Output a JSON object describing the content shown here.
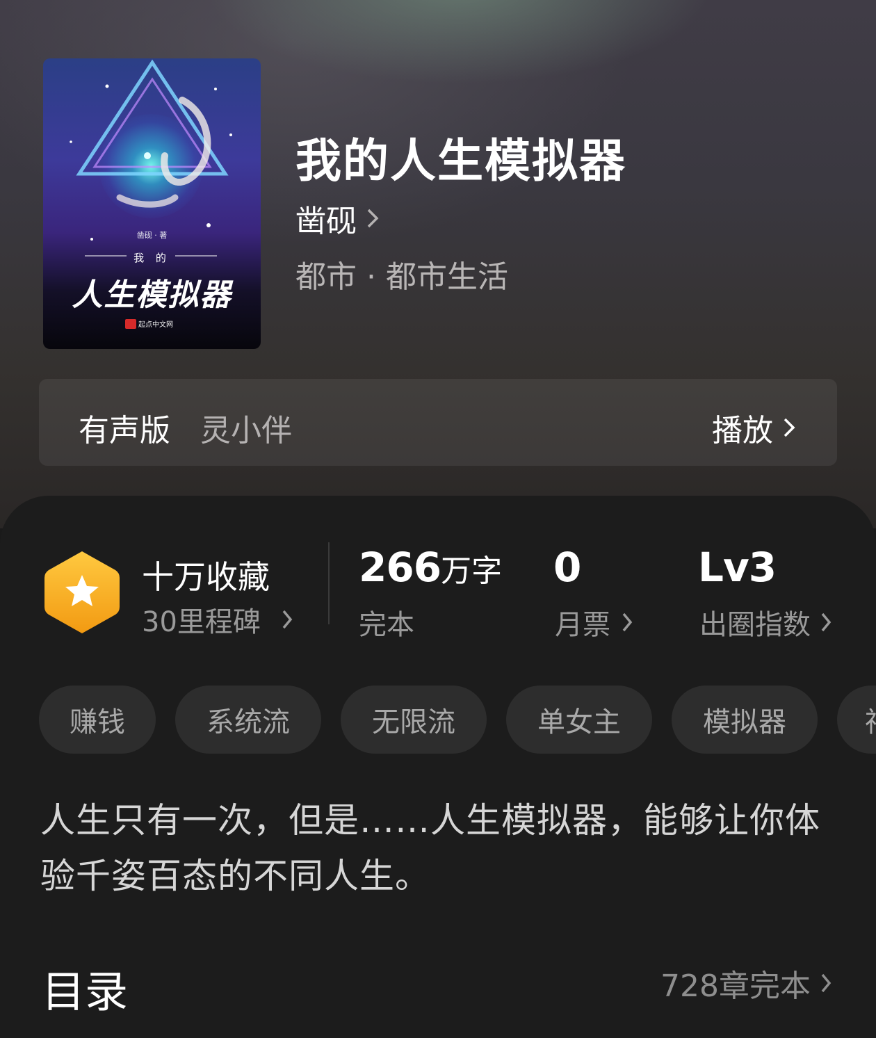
{
  "book": {
    "title": "我的人生模拟器",
    "author": "凿砚",
    "genre": "都市 · 都市生活"
  },
  "cover": {
    "author_text": "凿砚 · 著",
    "subtitle": "我 的",
    "title": "人生模拟器",
    "publisher": "起点中文网",
    "publisher_badge": "起"
  },
  "audio": {
    "label": "有声版",
    "narrator": "灵小伴",
    "play_label": "播放"
  },
  "stats": {
    "milestone_title": "十万收藏",
    "milestone_sub": "30里程碑",
    "words_number": "266",
    "words_unit": "万字",
    "words_sub": "完本",
    "votes_number": "0",
    "votes_sub": "月票",
    "index_number": "Lv3",
    "index_sub": "出圈指数"
  },
  "tags": [
    "赚钱",
    "系统流",
    "无限流",
    "单女主",
    "模拟器",
    "神"
  ],
  "description": "人生只有一次，但是……人生模拟器，能够让你体验千姿百态的不同人生。",
  "toc": {
    "label": "目录",
    "count": "728章完本"
  },
  "colors": {
    "medal": "#f5a623",
    "panel_bg": "#1c1c1c",
    "tag_bg": "#2d2d2d"
  }
}
